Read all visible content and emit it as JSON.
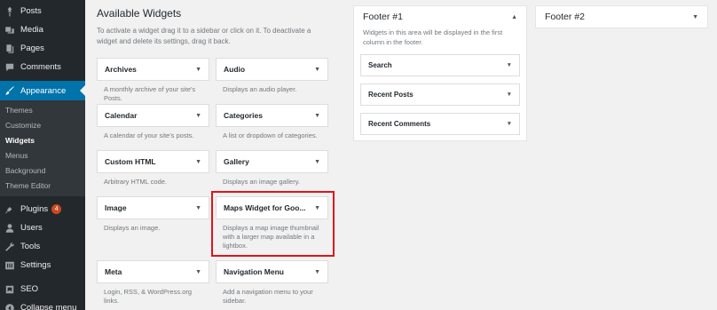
{
  "sidebar": {
    "items_top": [
      {
        "label": "Posts",
        "icon": "pin-icon"
      },
      {
        "label": "Media",
        "icon": "media-icon"
      },
      {
        "label": "Pages",
        "icon": "pages-icon"
      },
      {
        "label": "Comments",
        "icon": "comments-icon"
      }
    ],
    "active": {
      "label": "Appearance",
      "icon": "paintbrush-icon"
    },
    "submenu": [
      "Themes",
      "Customize",
      "Widgets",
      "Menus",
      "Background",
      "Theme Editor"
    ],
    "current_submenu": "Widgets",
    "items_bottom": [
      {
        "label": "Plugins",
        "icon": "plug-icon",
        "badge": "4"
      },
      {
        "label": "Users",
        "icon": "users-icon"
      },
      {
        "label": "Tools",
        "icon": "wrench-icon"
      },
      {
        "label": "Settings",
        "icon": "settings-icon"
      },
      {
        "label": "SEO",
        "icon": "seo-icon"
      },
      {
        "label": "Collapse menu",
        "icon": "collapse-icon"
      }
    ]
  },
  "available": {
    "title": "Available Widgets",
    "description": "To activate a widget drag it to a sidebar or click on it. To deactivate a widget and delete its settings, drag it back.",
    "widgets": [
      {
        "name": "Archives",
        "desc": "A monthly archive of your site's Posts."
      },
      {
        "name": "Audio",
        "desc": "Displays an audio player."
      },
      {
        "name": "Calendar",
        "desc": "A calendar of your site's posts."
      },
      {
        "name": "Categories",
        "desc": "A list or dropdown of categories."
      },
      {
        "name": "Custom HTML",
        "desc": "Arbitrary HTML code."
      },
      {
        "name": "Gallery",
        "desc": "Displays an image gallery."
      },
      {
        "name": "Image",
        "desc": "Displays an image."
      },
      {
        "name": "Maps Widget for Goo...",
        "desc": "Displays a map image thumbnail with a larger map available in a lightbox."
      },
      {
        "name": "Meta",
        "desc": "Login, RSS, & WordPress.org links."
      },
      {
        "name": "Navigation Menu",
        "desc": "Add a navigation menu to your sidebar."
      }
    ]
  },
  "footer1": {
    "title": "Footer #1",
    "description": "Widgets in this area will be displayed in the first column in the footer.",
    "widgets": [
      "Search",
      "Recent Posts",
      "Recent Comments"
    ]
  },
  "footer2": {
    "title": "Footer #2"
  },
  "colors": {
    "admin_bar": "#23282d",
    "accent": "#0073aa",
    "highlight": "#e0141b"
  }
}
